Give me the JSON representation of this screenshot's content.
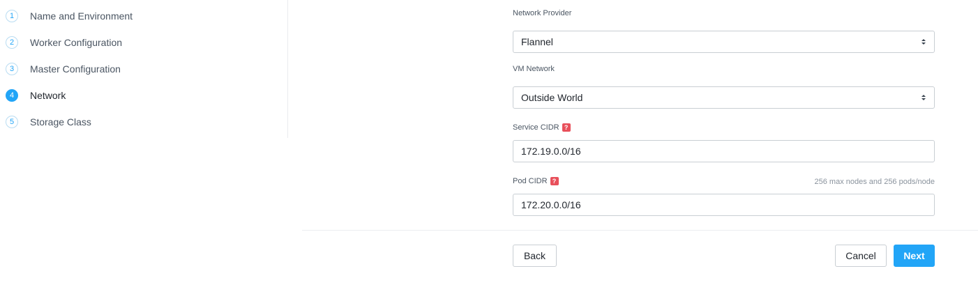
{
  "steps": [
    {
      "number": "1",
      "label": "Name and Environment"
    },
    {
      "number": "2",
      "label": "Worker Configuration"
    },
    {
      "number": "3",
      "label": "Master Configuration"
    },
    {
      "number": "4",
      "label": "Network"
    },
    {
      "number": "5",
      "label": "Storage Class"
    }
  ],
  "active_step": "4",
  "form": {
    "network_provider": {
      "label": "Network Provider",
      "value": "Flannel"
    },
    "vm_network": {
      "label": "VM Network",
      "value": "Outside World"
    },
    "service_cidr": {
      "label": "Service CIDR",
      "help": "?",
      "value": "172.19.0.0/16"
    },
    "pod_cidr": {
      "label": "Pod CIDR",
      "help": "?",
      "hint": "256 max nodes and 256 pods/node",
      "value": "172.20.0.0/16"
    }
  },
  "buttons": {
    "back": "Back",
    "cancel": "Cancel",
    "next": "Next"
  },
  "colors": {
    "accent": "#22a5f7",
    "help_badge": "#e8505b"
  }
}
